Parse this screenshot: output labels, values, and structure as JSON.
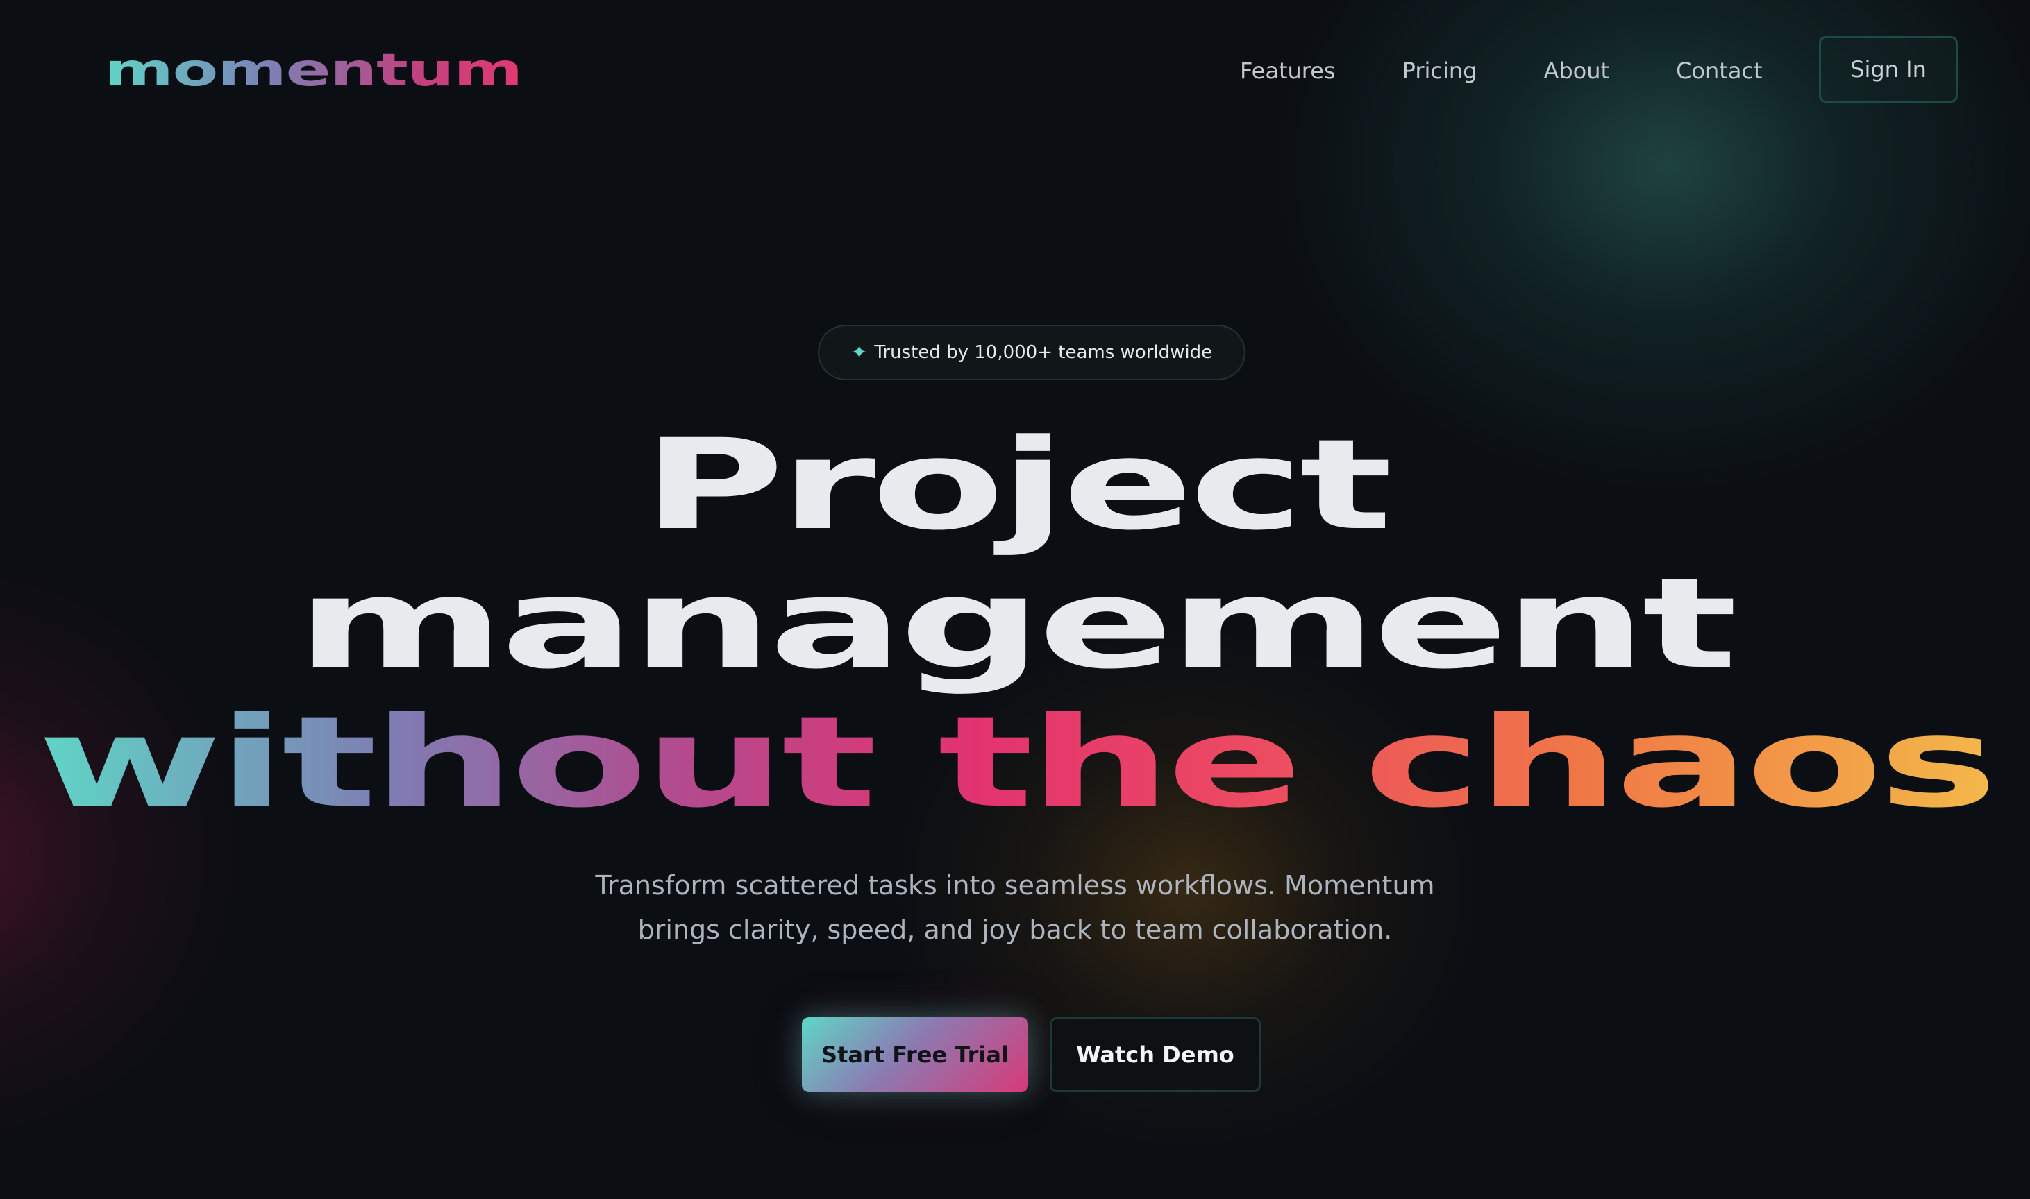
{
  "brand": {
    "logo_text": "momentum",
    "colors": {
      "background": "#0b0e13",
      "accent_teal": "#5fd6c6",
      "accent_magenta": "#e2336f",
      "accent_orange": "#f07a45",
      "accent_yellow": "#f3b84a"
    }
  },
  "nav": {
    "links": [
      {
        "label": "Features"
      },
      {
        "label": "Pricing"
      },
      {
        "label": "About"
      },
      {
        "label": "Contact"
      }
    ],
    "sign_in_label": "Sign In"
  },
  "hero": {
    "badge": {
      "icon": "sparkle-icon",
      "text": "Trusted by 10,000+ teams worldwide"
    },
    "headline": {
      "line1": "Project",
      "line2": "management",
      "line3": "without the chaos"
    },
    "subtitle_line1": "Transform scattered tasks into seamless workflows. Momentum",
    "subtitle_line2": "brings clarity, speed, and joy back to team collaboration.",
    "primary_cta": "Start Free Trial",
    "secondary_cta": "Watch Demo"
  }
}
